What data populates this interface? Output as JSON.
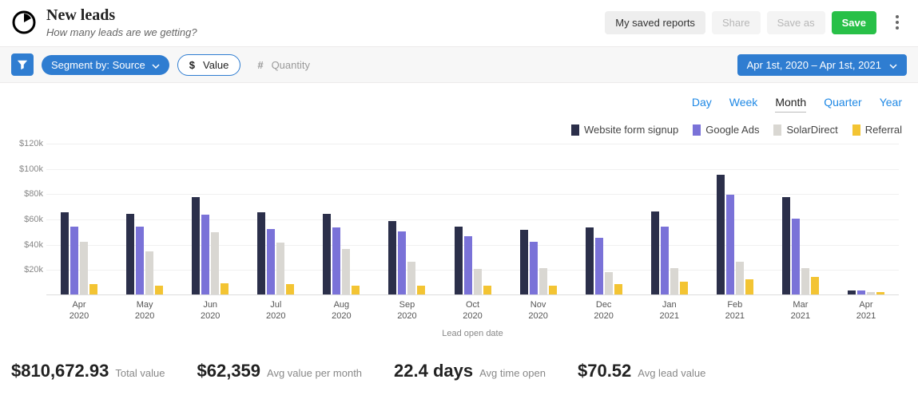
{
  "header": {
    "title": "New leads",
    "subtitle": "How many leads are we getting?",
    "buttons": {
      "my_saved": "My saved reports",
      "share": "Share",
      "save_as": "Save as",
      "save": "Save"
    }
  },
  "toolbar": {
    "segment_label": "Segment by: Source",
    "value_symbol": "$",
    "value_label": "Value",
    "quantity_symbol": "#",
    "quantity_label": "Quantity",
    "date_range": "Apr 1st, 2020 – Apr 1st, 2021"
  },
  "periods": {
    "day": "Day",
    "week": "Week",
    "month": "Month",
    "quarter": "Quarter",
    "year": "Year",
    "active": "month"
  },
  "legend": [
    {
      "name": "Website form signup",
      "color": "#2b2f4a"
    },
    {
      "name": "Google Ads",
      "color": "#7a72d8"
    },
    {
      "name": "SolarDirect",
      "color": "#d9d7d2"
    },
    {
      "name": "Referral",
      "color": "#f3c433"
    }
  ],
  "chart_data": {
    "type": "bar",
    "title": "New leads",
    "xlabel": "Lead open date",
    "ylabel": "",
    "ylim": [
      0,
      120000
    ],
    "y_ticks": [
      "$120k",
      "$100k",
      "$80k",
      "$60k",
      "$40k",
      "$20k"
    ],
    "categories": [
      "Apr 2020",
      "May 2020",
      "Jun 2020",
      "Jul 2020",
      "Aug 2020",
      "Sep 2020",
      "Oct 2020",
      "Nov 2020",
      "Dec 2020",
      "Jan 2021",
      "Feb 2021",
      "Mar 2021",
      "Apr 2021"
    ],
    "series": [
      {
        "name": "Website form signup",
        "color": "#2b2f4a",
        "values": [
          65000,
          64000,
          77000,
          65000,
          64000,
          58000,
          54000,
          51000,
          53000,
          66000,
          95000,
          77000,
          3000
        ]
      },
      {
        "name": "Google Ads",
        "color": "#7a72d8",
        "values": [
          54000,
          54000,
          63000,
          52000,
          53000,
          50000,
          46000,
          42000,
          45000,
          54000,
          79000,
          60000,
          3000
        ]
      },
      {
        "name": "SolarDirect",
        "color": "#d9d7d2",
        "values": [
          42000,
          34000,
          49000,
          41000,
          36000,
          26000,
          20000,
          21000,
          18000,
          21000,
          26000,
          21000,
          2000
        ]
      },
      {
        "name": "Referral",
        "color": "#f3c433",
        "values": [
          8000,
          7000,
          9000,
          8000,
          7000,
          7000,
          7000,
          7000,
          8000,
          10000,
          12000,
          14000,
          2000
        ]
      }
    ]
  },
  "stats": [
    {
      "value": "$810,672.93",
      "label": "Total value"
    },
    {
      "value": "$62,359",
      "label": "Avg value per month"
    },
    {
      "value": "22.4 days",
      "label": "Avg time open"
    },
    {
      "value": "$70.52",
      "label": "Avg lead value"
    }
  ]
}
